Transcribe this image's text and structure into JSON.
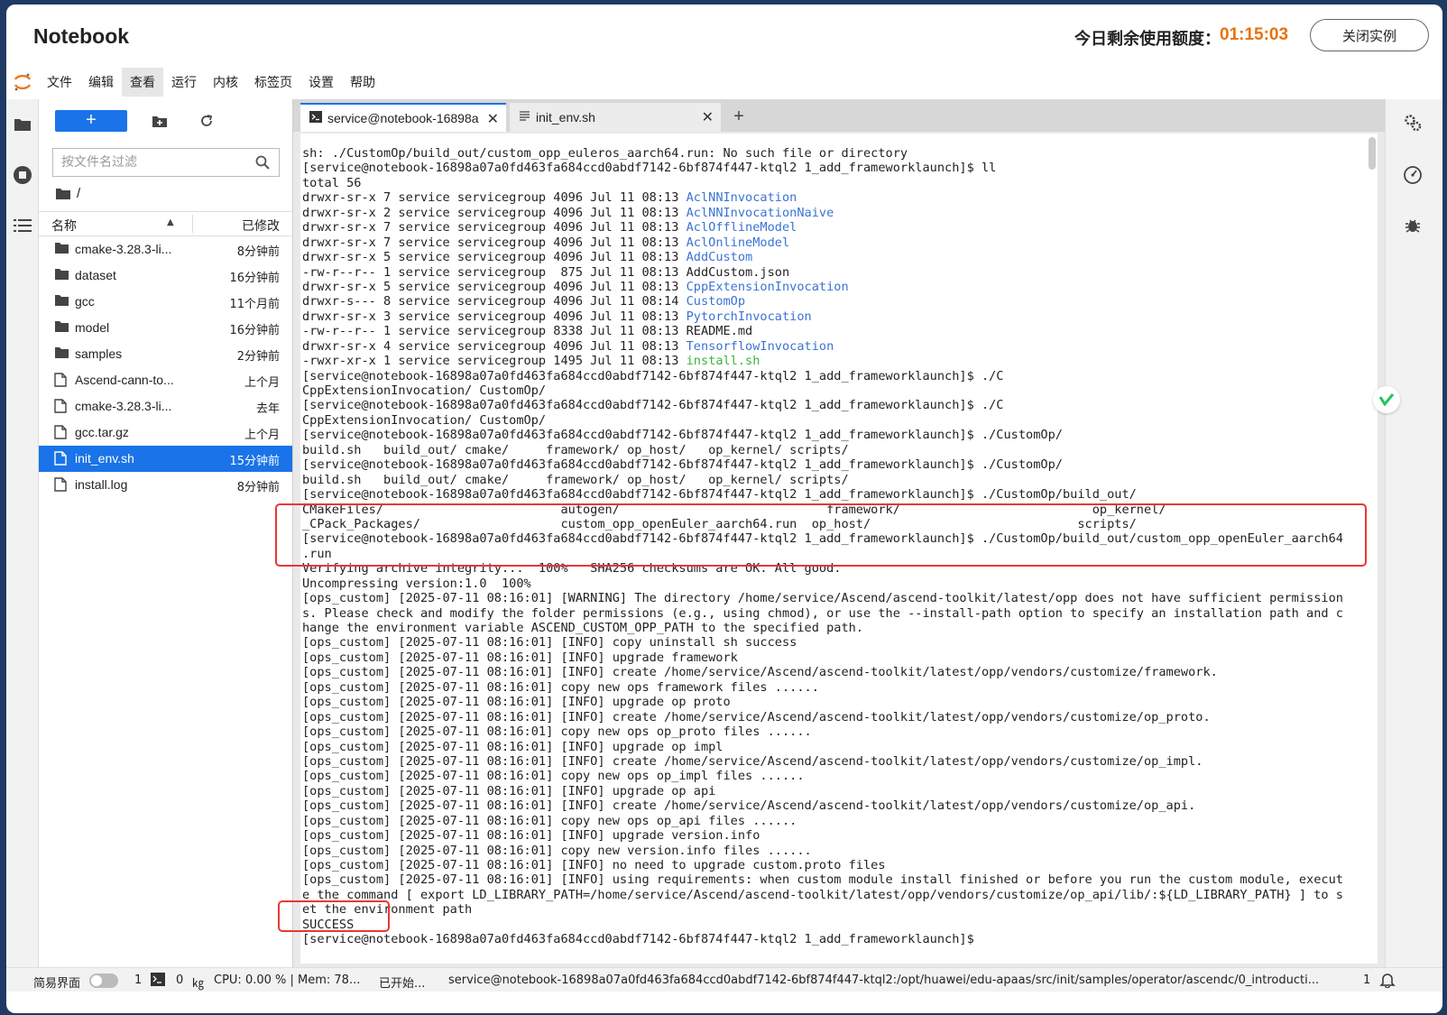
{
  "header": {
    "app_title": "Notebook",
    "quota_label": "今日剩余使用额度：",
    "quota_time": "01:15:03",
    "close_instance_label": "关闭实例"
  },
  "menu": [
    "文件",
    "编辑",
    "查看",
    "运行",
    "内核",
    "标签页",
    "设置",
    "帮助"
  ],
  "menu_active_index": 2,
  "file_browser": {
    "new_label": "+",
    "filter_placeholder": "按文件名过滤",
    "breadcrumb": "/",
    "col_name": "名称",
    "col_modified": "已修改",
    "files": [
      {
        "name": "cmake-3.28.3-li...",
        "modified": "8分钟前",
        "type": "folder"
      },
      {
        "name": "dataset",
        "modified": "16分钟前",
        "type": "folder"
      },
      {
        "name": "gcc",
        "modified": "11个月前",
        "type": "folder"
      },
      {
        "name": "model",
        "modified": "16分钟前",
        "type": "folder"
      },
      {
        "name": "samples",
        "modified": "2分钟前",
        "type": "folder"
      },
      {
        "name": "Ascend-cann-to...",
        "modified": "上个月",
        "type": "file"
      },
      {
        "name": "cmake-3.28.3-li...",
        "modified": "去年",
        "type": "file"
      },
      {
        "name": "gcc.tar.gz",
        "modified": "上个月",
        "type": "file"
      },
      {
        "name": "init_env.sh",
        "modified": "15分钟前",
        "type": "file",
        "selected": true
      },
      {
        "name": "install.log",
        "modified": "8分钟前",
        "type": "file"
      }
    ]
  },
  "tabs": [
    {
      "label": "service@notebook-16898a"
    },
    {
      "label": "init_env.sh"
    }
  ],
  "terminal_lines": [
    [
      {
        "t": "sh: ./CustomOp/build_out/custom_opp_euleros_aarch64.run: No such file or directory"
      }
    ],
    [
      {
        "t": "[service@notebook-16898a07a0fd463fa684ccd0abdf7142-6bf874f447-ktql2 1_add_frameworklaunch]$ ll"
      }
    ],
    [
      {
        "t": "total 56"
      }
    ],
    [
      {
        "t": "drwxr-sr-x 7 service servicegroup 4096 Jul 11 08:13 "
      },
      {
        "t": "AclNNInvocation",
        "c": "blue"
      }
    ],
    [
      {
        "t": "drwxr-sr-x 2 service servicegroup 4096 Jul 11 08:13 "
      },
      {
        "t": "AclNNInvocationNaive",
        "c": "blue"
      }
    ],
    [
      {
        "t": "drwxr-sr-x 7 service servicegroup 4096 Jul 11 08:13 "
      },
      {
        "t": "AclOfflineModel",
        "c": "blue"
      }
    ],
    [
      {
        "t": "drwxr-sr-x 7 service servicegroup 4096 Jul 11 08:13 "
      },
      {
        "t": "AclOnlineModel",
        "c": "blue"
      }
    ],
    [
      {
        "t": "drwxr-sr-x 5 service servicegroup 4096 Jul 11 08:13 "
      },
      {
        "t": "AddCustom",
        "c": "blue"
      }
    ],
    [
      {
        "t": "-rw-r--r-- 1 service servicegroup  875 Jul 11 08:13 AddCustom.json"
      }
    ],
    [
      {
        "t": "drwxr-sr-x 5 service servicegroup 4096 Jul 11 08:13 "
      },
      {
        "t": "CppExtensionInvocation",
        "c": "blue"
      }
    ],
    [
      {
        "t": "drwxr-s--- 8 service servicegroup 4096 Jul 11 08:14 "
      },
      {
        "t": "CustomOp",
        "c": "blue"
      }
    ],
    [
      {
        "t": "drwxr-sr-x 3 service servicegroup 4096 Jul 11 08:13 "
      },
      {
        "t": "PytorchInvocation",
        "c": "blue"
      }
    ],
    [
      {
        "t": "-rw-r--r-- 1 service servicegroup 8338 Jul 11 08:13 README.md"
      }
    ],
    [
      {
        "t": "drwxr-sr-x 4 service servicegroup 4096 Jul 11 08:13 "
      },
      {
        "t": "TensorflowInvocation",
        "c": "blue"
      }
    ],
    [
      {
        "t": "-rwxr-xr-x 1 service servicegroup 1495 Jul 11 08:13 "
      },
      {
        "t": "install.sh",
        "c": "green"
      }
    ],
    [
      {
        "t": "[service@notebook-16898a07a0fd463fa684ccd0abdf7142-6bf874f447-ktql2 1_add_frameworklaunch]$ ./C"
      }
    ],
    [
      {
        "t": "CppExtensionInvocation/ CustomOp/"
      }
    ],
    [
      {
        "t": "[service@notebook-16898a07a0fd463fa684ccd0abdf7142-6bf874f447-ktql2 1_add_frameworklaunch]$ ./C"
      }
    ],
    [
      {
        "t": "CppExtensionInvocation/ CustomOp/"
      }
    ],
    [
      {
        "t": "[service@notebook-16898a07a0fd463fa684ccd0abdf7142-6bf874f447-ktql2 1_add_frameworklaunch]$ ./CustomOp/"
      }
    ],
    [
      {
        "t": "build.sh   build_out/ cmake/     framework/ op_host/   op_kernel/ scripts/"
      }
    ],
    [
      {
        "t": "[service@notebook-16898a07a0fd463fa684ccd0abdf7142-6bf874f447-ktql2 1_add_frameworklaunch]$ ./CustomOp/"
      }
    ],
    [
      {
        "t": "build.sh   build_out/ cmake/     framework/ op_host/   op_kernel/ scripts/"
      }
    ],
    [
      {
        "t": "[service@notebook-16898a07a0fd463fa684ccd0abdf7142-6bf874f447-ktql2 1_add_frameworklaunch]$ ./CustomOp/build_out/"
      }
    ],
    [
      {
        "t": "CMakeFiles/                        autogen/                            framework/                          op_kernel/"
      }
    ],
    [
      {
        "t": "_CPack_Packages/                   custom_opp_openEuler_aarch64.run  op_host/                            scripts/"
      }
    ],
    [
      {
        "t": "[service@notebook-16898a07a0fd463fa684ccd0abdf7142-6bf874f447-ktql2 1_add_frameworklaunch]$ ./CustomOp/build_out/custom_opp_openEuler_aarch64"
      }
    ],
    [
      {
        "t": ".run"
      }
    ],
    [
      {
        "t": "Verifying archive integrity...  100%   SHA256 checksums are OK. All good."
      }
    ],
    [
      {
        "t": "Uncompressing version:1.0  100%"
      }
    ],
    [
      {
        "t": "[ops_custom] [2025-07-11 08:16:01] [WARNING] The directory /home/service/Ascend/ascend-toolkit/latest/opp does not have sufficient permission"
      }
    ],
    [
      {
        "t": "s. Please check and modify the folder permissions (e.g., using chmod), or use the --install-path option to specify an installation path and c"
      }
    ],
    [
      {
        "t": "hange the environment variable ASCEND_CUSTOM_OPP_PATH to the specified path."
      }
    ],
    [
      {
        "t": "[ops_custom] [2025-07-11 08:16:01] [INFO] copy uninstall sh success"
      }
    ],
    [
      {
        "t": "[ops_custom] [2025-07-11 08:16:01] [INFO] upgrade framework"
      }
    ],
    [
      {
        "t": "[ops_custom] [2025-07-11 08:16:01] [INFO] create /home/service/Ascend/ascend-toolkit/latest/opp/vendors/customize/framework."
      }
    ],
    [
      {
        "t": "[ops_custom] [2025-07-11 08:16:01] copy new ops framework files ......"
      }
    ],
    [
      {
        "t": "[ops_custom] [2025-07-11 08:16:01] [INFO] upgrade op proto"
      }
    ],
    [
      {
        "t": "[ops_custom] [2025-07-11 08:16:01] [INFO] create /home/service/Ascend/ascend-toolkit/latest/opp/vendors/customize/op_proto."
      }
    ],
    [
      {
        "t": "[ops_custom] [2025-07-11 08:16:01] copy new ops op_proto files ......"
      }
    ],
    [
      {
        "t": "[ops_custom] [2025-07-11 08:16:01] [INFO] upgrade op impl"
      }
    ],
    [
      {
        "t": "[ops_custom] [2025-07-11 08:16:01] [INFO] create /home/service/Ascend/ascend-toolkit/latest/opp/vendors/customize/op_impl."
      }
    ],
    [
      {
        "t": "[ops_custom] [2025-07-11 08:16:01] copy new ops op_impl files ......"
      }
    ],
    [
      {
        "t": "[ops_custom] [2025-07-11 08:16:01] [INFO] upgrade op api"
      }
    ],
    [
      {
        "t": "[ops_custom] [2025-07-11 08:16:01] [INFO] create /home/service/Ascend/ascend-toolkit/latest/opp/vendors/customize/op_api."
      }
    ],
    [
      {
        "t": "[ops_custom] [2025-07-11 08:16:01] copy new ops op_api files ......"
      }
    ],
    [
      {
        "t": "[ops_custom] [2025-07-11 08:16:01] [INFO] upgrade version.info"
      }
    ],
    [
      {
        "t": "[ops_custom] [2025-07-11 08:16:01] copy new version.info files ......"
      }
    ],
    [
      {
        "t": "[ops_custom] [2025-07-11 08:16:01] [INFO] no need to upgrade custom.proto files"
      }
    ],
    [
      {
        "t": "[ops_custom] [2025-07-11 08:16:01] [INFO] using requirements: when custom module install finished or before you run the custom module, execut"
      }
    ],
    [
      {
        "t": "e the command [ export LD_LIBRARY_PATH=/home/service/Ascend/ascend-toolkit/latest/opp/vendors/customize/op_api/lib/:${LD_LIBRARY_PATH} ] to s"
      }
    ],
    [
      {
        "t": "et the environment path"
      }
    ],
    [
      {
        "t": "SUCCESS"
      }
    ],
    [
      {
        "t": "[service@notebook-16898a07a0fd463fa684ccd0abdf7142-6bf874f447-ktql2 1_add_frameworklaunch]$ "
      }
    ]
  ],
  "statusbar": {
    "simple_mode_label": "简易界面",
    "count_terminals": "1",
    "count_kernels": "0",
    "resources": "CPU: 0.00 % | Mem: 78...",
    "status": "已开始...",
    "path": "service@notebook-16898a07a0fd463fa684ccd0abdf7142-6bf874f447-ktql2:/opt/huawei/edu-apaas/src/init/samples/operator/ascendc/0_introducti...",
    "line_count": "1"
  },
  "colors": {
    "accent": "#1a73e8",
    "quota": "#e8720c",
    "highlight": "#e53935",
    "dir_blue": "#3b73d4",
    "exec_green": "#3ab53a"
  }
}
